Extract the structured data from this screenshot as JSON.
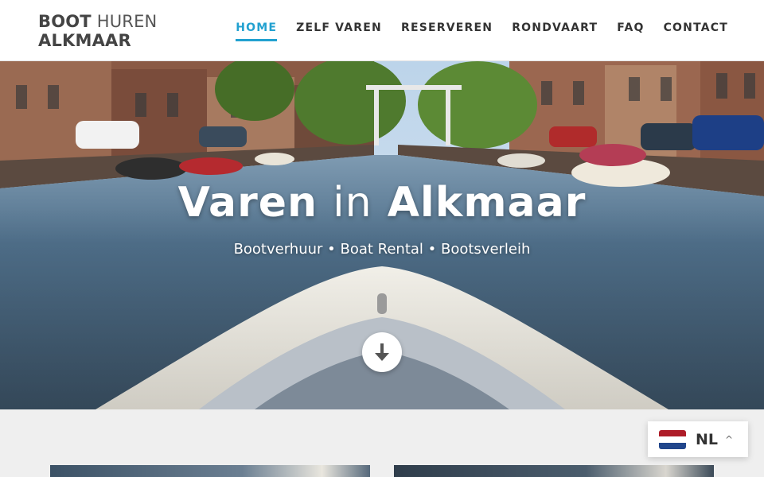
{
  "header": {
    "logo_line1_bold": "BOOT",
    "logo_line1_light": "HUREN",
    "logo_line2": "ALKMAAR",
    "nav": [
      {
        "label": "HOME",
        "active": true
      },
      {
        "label": "ZELF VAREN",
        "active": false
      },
      {
        "label": "RESERVEREN",
        "active": false
      },
      {
        "label": "RONDVAART",
        "active": false
      },
      {
        "label": "FAQ",
        "active": false
      },
      {
        "label": "CONTACT",
        "active": false
      }
    ]
  },
  "hero": {
    "title_part1": "Varen",
    "title_part2": "in",
    "title_part3": "Alkmaar",
    "subtitle": "Bootverhuur • Boat Rental • Bootsverleih",
    "scroll_icon": "arrow-down-icon"
  },
  "language_switcher": {
    "code": "NL",
    "flag_icon": "netherlands-flag-icon",
    "caret_icon": "chevron-up-icon"
  },
  "colors": {
    "accent": "#22a1d0",
    "flag_red": "#ae1c28",
    "flag_white": "#ffffff",
    "flag_blue": "#21468b"
  }
}
